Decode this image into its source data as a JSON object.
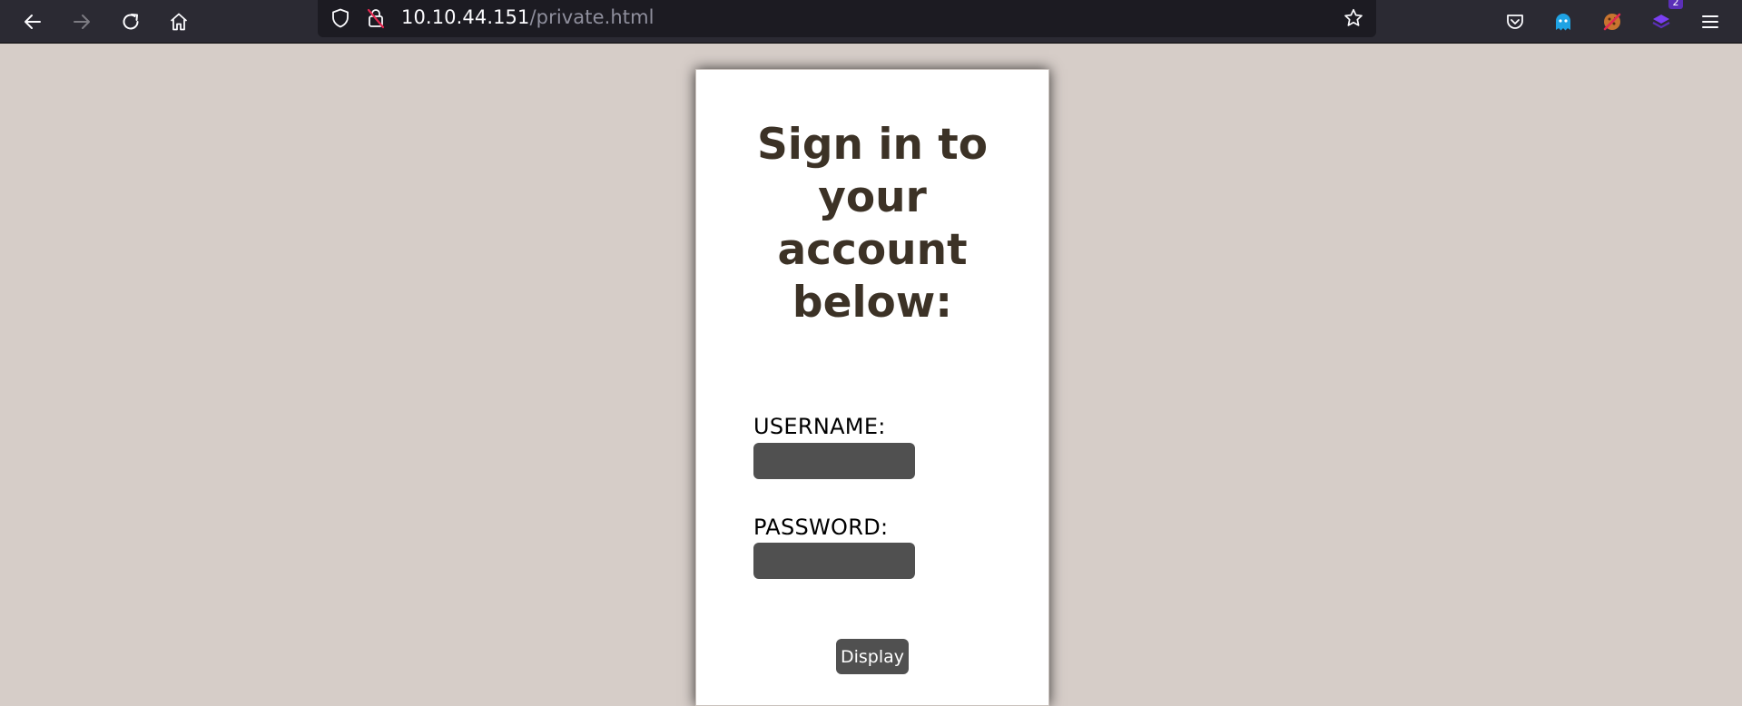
{
  "browser": {
    "url_host": "10.10.44.151",
    "url_path": "/private.html",
    "extension_badge_count": "2",
    "icons": {
      "back": "back-arrow-icon",
      "forward": "forward-arrow-icon",
      "reload": "reload-icon",
      "home": "home-icon",
      "tracking_protection": "shield-icon",
      "insecure_connection": "insecure-lock-icon",
      "bookmark": "star-icon",
      "pocket": "pocket-icon",
      "ghostery": "ghost-icon",
      "cookie_extension": "cookie-icon",
      "extension_stack": "purple-stack-icon",
      "menu": "hamburger-menu-icon"
    },
    "colors": {
      "toolbar_bg": "#2b2a33",
      "urlbar_bg": "#1c1b22",
      "url_text": "#fbfbfe",
      "url_path_text": "#8f8f9d"
    }
  },
  "page": {
    "title": "Sign in to your account below:",
    "username_label": "USERNAME:",
    "username_value": "",
    "password_label": "PASSWORD:",
    "password_value": "",
    "submit_label": "Display",
    "colors": {
      "background": "#d6cdc8",
      "card": "#ffffff",
      "title_text": "#3c3226",
      "input_bg": "#505050",
      "button_bg": "#505050"
    }
  }
}
